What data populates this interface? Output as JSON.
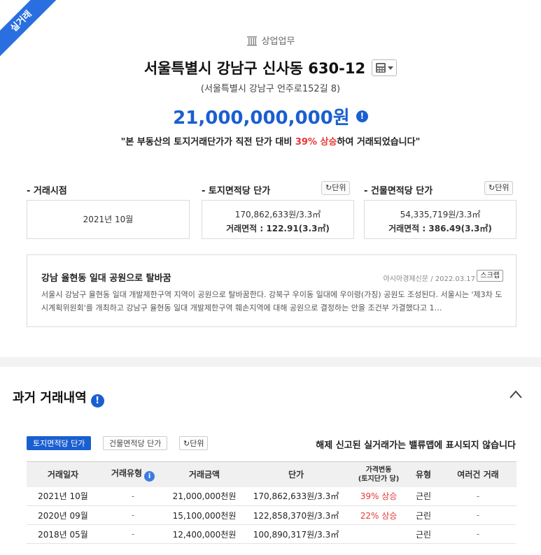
{
  "ribbon": "실거래",
  "header": {
    "category": "상업업무",
    "address": "서울특별시 강남구 신사동 630-12",
    "road_address": "(서울특별시 강남구 언주로152길 8)",
    "price": "21,000,000,000원",
    "info_icon": "!",
    "notice_prefix": "\"본 부동산의 토지거래단가가 직전 단가 대비",
    "notice_rate": "39% 상승",
    "notice_suffix": "하여 거래되었습니다\""
  },
  "summary": {
    "deal_time_label": "- 거래시점",
    "deal_time_value": "2021년 10월",
    "land_label": "- 토지면적당 단가",
    "land_unit_button": "단위",
    "land_price": "170,862,633원/3.3㎡",
    "land_area": "거래면적 : 122.91(3.3㎡)",
    "building_label": "- 건물면적당 단가",
    "building_unit_button": "단위",
    "building_price": "54,335,719원/3.3㎡",
    "building_area": "거래면적 : 386.49(3.3㎡)"
  },
  "news": {
    "title": "강남 율현동 일대 공원으로 탈바꿈",
    "source_date": "아시아경제신문 / 2022.03.17",
    "scrap_button": "스크랩",
    "body": "서울시 강남구 율현동 일대 개발제한구역 지역이 공원으로 탈바꿈한다. 강북구 우이동 일대에 우이령(가칭) 공원도 조성된다. 서울시는 '제3차 도시계획위원회'를 개최하고 강남구 율현동 일대 개발제한구역 훼손지역에 대해 공원으로 결정하는 안을 조건부 가결했다고 1…"
  },
  "history": {
    "title": "과거 거래내역",
    "info_icon": "!",
    "tab_land": "토지면적당 단가",
    "tab_building": "건물면적당 단가",
    "unit_button": "단위",
    "note": "해제 신고된 실거래가는 밸류맵에 표시되지 않습니다",
    "headers": {
      "date": "거래일자",
      "type": "거래유형",
      "amount": "거래금액",
      "unit_price": "단가",
      "change_line1": "가격변동",
      "change_line2": "(토지단가 당)",
      "kind": "유형",
      "multi": "여러건 거래"
    },
    "rows": [
      {
        "date": "2021년 10월",
        "type": "-",
        "amount": "21,000,000천원",
        "unit_price": "170,862,633원/3.3㎡",
        "change": "39% 상승",
        "kind": "근린",
        "multi": "-"
      },
      {
        "date": "2020년 09월",
        "type": "-",
        "amount": "15,100,000천원",
        "unit_price": "122,858,370원/3.3㎡",
        "change": "22% 상승",
        "kind": "근린",
        "multi": "-"
      },
      {
        "date": "2018년 05월",
        "type": "-",
        "amount": "12,400,000천원",
        "unit_price": "100,890,317원/3.3㎡",
        "change": "",
        "kind": "근린",
        "multi": "-"
      }
    ]
  },
  "colors": {
    "accent_blue": "#1a5fd0",
    "rise_red": "#e53935",
    "ribbon_blue": "#2a6fe0"
  },
  "icons": [
    "building-icon",
    "calculator-icon",
    "info-icon",
    "refresh-icon",
    "chevron-up-icon"
  ]
}
